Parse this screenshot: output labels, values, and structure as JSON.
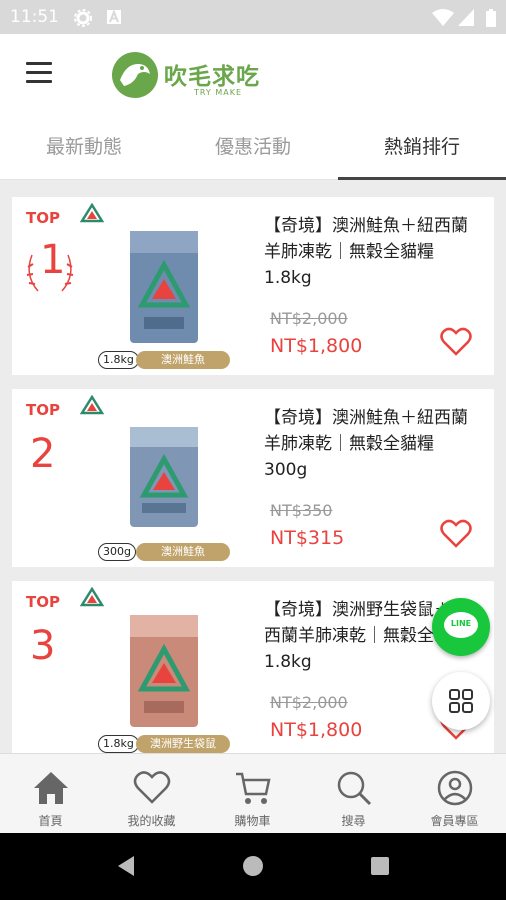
{
  "status_bar": {
    "time": "11:51"
  },
  "app": {
    "logo_text": "吹毛求吃",
    "logo_sub": "TRY MAKE"
  },
  "tabs": [
    {
      "label": "最新動態"
    },
    {
      "label": "優惠活動"
    },
    {
      "label": "熱銷排行"
    }
  ],
  "products": [
    {
      "top_label": "TOP",
      "rank": "1",
      "name": "【奇境】澳洲鮭魚＋紐西蘭羊肺凍乾｜無穀全貓糧 1.8kg",
      "weight": "1.8kg",
      "flavor": "澳洲鮭魚",
      "price_old": "NT$2,000",
      "price_new": "NT$1,800"
    },
    {
      "top_label": "TOP",
      "rank": "2",
      "name": "【奇境】澳洲鮭魚＋紐西蘭羊肺凍乾｜無穀全貓糧 300g",
      "weight": "300g",
      "flavor": "澳洲鮭魚",
      "price_old": "NT$350",
      "price_new": "NT$315"
    },
    {
      "top_label": "TOP",
      "rank": "3",
      "name": "【奇境】澳洲野生袋鼠＋紐西蘭羊肺凍乾｜無穀全貓糧 1.8kg",
      "weight": "1.8kg",
      "flavor": "澳洲野生袋鼠",
      "price_old": "NT$2,000",
      "price_new": "NT$1,800"
    }
  ],
  "fab": {
    "line_label": "LINE"
  },
  "bottom_nav": [
    {
      "label": "首頁",
      "icon": "home-icon"
    },
    {
      "label": "我的收藏",
      "icon": "heart-icon"
    },
    {
      "label": "購物車",
      "icon": "cart-icon"
    },
    {
      "label": "搜尋",
      "icon": "search-icon"
    },
    {
      "label": "會員專區",
      "icon": "user-icon"
    }
  ],
  "colors": {
    "accent": "#e8433e",
    "brand": "#6aa64a",
    "line": "#18c73c",
    "tag": "#bfa36a"
  }
}
